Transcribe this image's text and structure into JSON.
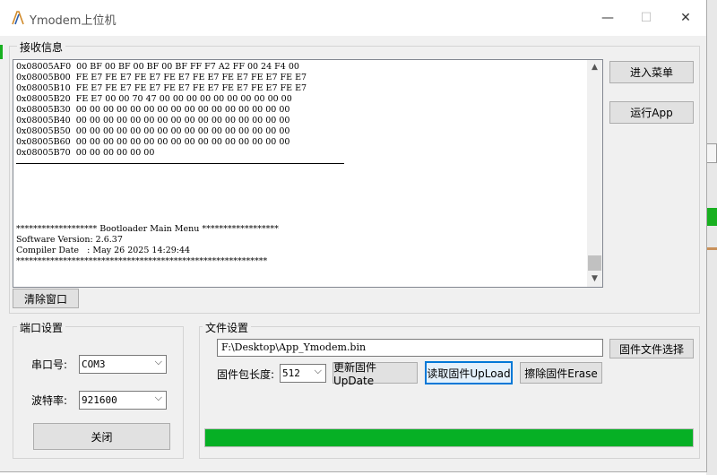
{
  "window": {
    "title": "Ymodem上位机"
  },
  "receive": {
    "group_label": "接收信息",
    "hex_lines": "0x08005AF0  00 BF 00 BF 00 BF 00 BF FF F7 A2 FF 00 24 F4 00\n0x08005B00  FE E7 FE E7 FE E7 FE E7 FE E7 FE E7 FE E7 FE E7\n0x08005B10  FE E7 FE E7 FE E7 FE E7 FE E7 FE E7 FE E7 FE E7\n0x08005B20  FE E7 00 00 70 47 00 00 00 00 00 00 00 00 00 00\n0x08005B30  00 00 00 00 00 00 00 00 00 00 00 00 00 00 00 00\n0x08005B40  00 00 00 00 00 00 00 00 00 00 00 00 00 00 00 00\n0x08005B50  00 00 00 00 00 00 00 00 00 00 00 00 00 00 00 00\n0x08005B60  00 00 00 00 00 00 00 00 00 00 00 00 00 00 00 00\n0x08005B70  00 00 00 00 00 00",
    "menu_lines": "******************* Bootloader Main Menu ******************\nSoftware Version: 2.6.37\nCompiler Date   : May 26 2025 14:29:44\n***********************************************************",
    "clear_label": "清除窗口"
  },
  "side_buttons": {
    "enter_menu": "进入菜单",
    "run_app": "运行App"
  },
  "port": {
    "group_label": "端口设置",
    "port_label": "串口号:",
    "port_value": "COM3",
    "baud_label": "波特率:",
    "baud_value": "921600",
    "close_label": "关闭"
  },
  "file": {
    "group_label": "文件设置",
    "path": "F:\\Desktop\\App_Ymodem.bin",
    "select_label": "固件文件选择",
    "pkg_label": "固件包长度:",
    "pkg_value": "512",
    "update_label": "更新固件UpDate",
    "upload_label": "读取固件UpLoad",
    "erase_label": "擦除固件Erase",
    "progress": 1.0
  },
  "colors": {
    "progress": "#06b025",
    "focus_border": "#0078d7"
  }
}
